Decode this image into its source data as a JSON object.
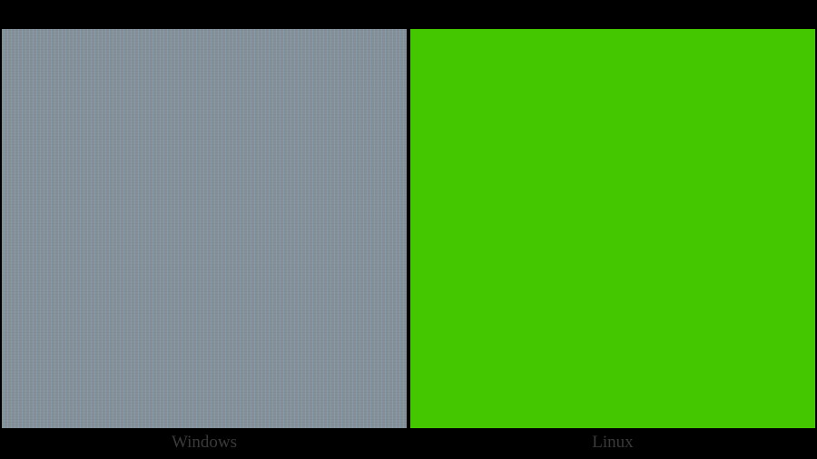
{
  "panels": [
    {
      "label": "Windows",
      "content_type": "noise-pattern"
    },
    {
      "label": "Linux",
      "content_type": "solid-green"
    }
  ],
  "colors": {
    "background": "#000000",
    "green": "#45c700",
    "noise_base": "#8a9ba3",
    "label": "#3a3a3a"
  }
}
